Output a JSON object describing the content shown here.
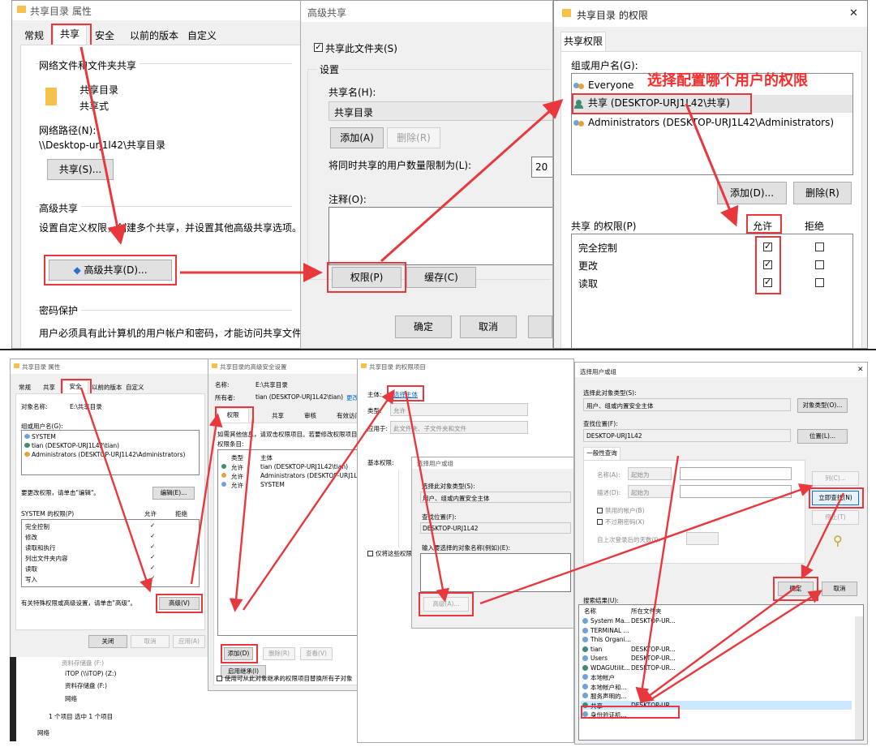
{
  "top": {
    "props": {
      "title": "共享目录 属性",
      "tabs": [
        "常规",
        "共享",
        "安全",
        "以前的版本",
        "自定义"
      ],
      "net_section": "网络文件和文件夹共享",
      "folder_name": "共享目录",
      "folder_state": "共享式",
      "net_path_label": "网络路径(N):",
      "net_path": "\\\\Desktop-urj1l42\\共享目录",
      "share_btn": "共享(S)...",
      "adv_section": "高级共享",
      "adv_desc": "设置自定义权限，创建多个共享，并设置其他高级共享选项。",
      "adv_btn": "高级共享(D)...",
      "pwd_section": "密码保护",
      "pwd_desc": "用户必须具有此计算机的用户帐户和密码，才能访问共享文件夹。"
    },
    "adv": {
      "title": "高级共享",
      "share_check": "共享此文件夹(S)",
      "settings": "设置",
      "share_name_label": "共享名(H):",
      "share_name": "共享目录",
      "add_btn": "添加(A)",
      "remove_btn": "删除(R)",
      "limit_label": "将同时共享的用户数量限制为(L):",
      "limit_value": "20",
      "comment_label": "注释(O):",
      "perm_btn": "权限(P)",
      "cache_btn": "缓存(C)",
      "ok_btn": "确定",
      "cancel_btn": "取消"
    },
    "perm": {
      "title": "共享目录 的权限",
      "close": "✕",
      "tab": "共享权限",
      "group_label": "组或用户名(G):",
      "users": [
        "Everyone",
        "共享 (DESKTOP-URJ1L42\\共享)",
        "Administrators (DESKTOP-URJ1L42\\Administrators)"
      ],
      "add_btn": "添加(D)...",
      "remove_btn": "删除(R)",
      "perm_label": "共享 的权限(P)",
      "allow": "允许",
      "deny": "拒绝",
      "rows": [
        {
          "name": "完全控制",
          "allow": "☑",
          "deny": ""
        },
        {
          "name": "更改",
          "allow": "☑",
          "deny": ""
        },
        {
          "name": "读取",
          "allow": "☑",
          "deny": ""
        }
      ]
    },
    "annotation": "选择配置哪个用户的权限"
  },
  "bottom": {
    "props": {
      "title": "共享目录 属性",
      "tabs": [
        "常规",
        "共享",
        "安全",
        "以前的版本",
        "自定义"
      ],
      "object_label": "对象名称:",
      "object_value": "E:\\共享目录",
      "group_label": "组或用户名(G):",
      "users": [
        "SYSTEM",
        "tian (DESKTOP-URJ1L42\\tian)",
        "Administrators (DESKTOP-URJ1L42\\Administrators)"
      ],
      "change_text": "要更改权限，请单击\"编辑\"。",
      "edit_btn": "编辑(E)...",
      "perm_label": "SYSTEM 的权限(P)",
      "allow": "允许",
      "deny": "拒绝",
      "rows": [
        {
          "name": "完全控制",
          "allow": "✓"
        },
        {
          "name": "修改",
          "allow": "✓"
        },
        {
          "name": "读取和执行",
          "allow": "✓"
        },
        {
          "name": "列出文件夹内容",
          "allow": "✓"
        },
        {
          "name": "读取",
          "allow": "✓"
        },
        {
          "name": "写入",
          "allow": "✓"
        }
      ],
      "special_text": "有关特殊权限或高级设置，请单击\"高级\"。",
      "adv_btn": "高级(V)",
      "close_btn": "关闭",
      "cancel_btn": "取消",
      "apply_btn": "应用(A)"
    },
    "explorer": {
      "items": [
        "资料存储盘 (F:)",
        "iTOP (\\\\iTOP) (Z:)",
        "资料存储盘 (F:)",
        "网络"
      ],
      "status": "1 个项目    选中 1 个项目",
      "net": "网络"
    },
    "adv_sec": {
      "title": "共享目录的高级安全设置",
      "name_label": "名称:",
      "name_value": "E:\\共享目录",
      "owner_label": "所有者:",
      "owner_value": "tian (DESKTOP-URJ1L42\\tian)",
      "owner_link": "更改",
      "tabs": [
        "权限",
        "共享",
        "审核",
        "有效访问"
      ],
      "info": "如需其他信息，请双击权限项目。若要修改权限项目",
      "entries_label": "权限条目:",
      "col_type": "类型",
      "col_principal": "主体",
      "entries": [
        {
          "type": "允许",
          "principal": "tian (DESKTOP-URJ1L42\\tian)"
        },
        {
          "type": "允许",
          "principal": "Administrators (DESKTOP-URJ1L42\\"
        },
        {
          "type": "允许",
          "principal": "SYSTEM"
        }
      ],
      "add_btn": "添加(D)",
      "remove_btn": "删除(R)",
      "view_btn": "查看(V)",
      "disable_btn": "启用继承(I)",
      "replace_check": "使用可从此对象继承的权限项目替换所有子对象"
    },
    "perm_entry": {
      "title": "共享目录 的权限项目",
      "principal_label": "主体:",
      "principal_link": "选择主体",
      "type_label": "类型:",
      "type_value": "允许",
      "applies_label": "应用于:",
      "applies_value": "此文件夹、子文件夹和文件",
      "basic_label": "基本权限:",
      "only_check": "仅将这些权限"
    },
    "select_small": {
      "title": "选择用户或组",
      "type_label": "选择此对象类型(S):",
      "type_value": "用户、组或内置安全主体",
      "loc_label": "查找位置(F):",
      "loc_value": "DESKTOP-URJ1L42",
      "name_label": "输入要选择的对象名称(例如)(E):",
      "adv_btn": "高级(A)..."
    },
    "select_big": {
      "title": "选择用户或组",
      "close": "✕",
      "type_label": "选择此对象类型(S):",
      "type_value": "用户、组或内置安全主体",
      "type_btn": "对象类型(O)...",
      "loc_label": "查找位置(F):",
      "loc_value": "DESKTOP-URJ1L42",
      "loc_btn": "位置(L)...",
      "tab": "一般性查询",
      "name_label": "名称(A):",
      "desc_label": "描述(D):",
      "starts": "起始为",
      "disabled_check": "禁用的帐户(B)",
      "noexpire_check": "不过期密码(X)",
      "days_label": "自上次登录后的天数(I):",
      "col_btn": "列(C)...",
      "find_btn": "立即查找(N)",
      "stop_btn": "停止(T)",
      "ok_btn": "确定",
      "cancel_btn": "取消",
      "results_label": "搜索结果(U):",
      "col_name": "名称",
      "col_folder": "所在文件夹",
      "results": [
        {
          "name": "System Ma...",
          "folder": "DESKTOP-UR..."
        },
        {
          "name": "TERMINAL ...",
          "folder": ""
        },
        {
          "name": "This Organi...",
          "folder": ""
        },
        {
          "name": "tian",
          "folder": "DESKTOP-UR..."
        },
        {
          "name": "Users",
          "folder": "DESKTOP-UR..."
        },
        {
          "name": "WDAGUtilit...",
          "folder": "DESKTOP-UR..."
        },
        {
          "name": "本地帐户",
          "folder": ""
        },
        {
          "name": "本地帐户和...",
          "folder": ""
        },
        {
          "name": "服务声明的...",
          "folder": ""
        },
        {
          "name": "共享",
          "folder": "DESKTOP-UR..."
        },
        {
          "name": "身份验证机...",
          "folder": ""
        }
      ]
    }
  }
}
